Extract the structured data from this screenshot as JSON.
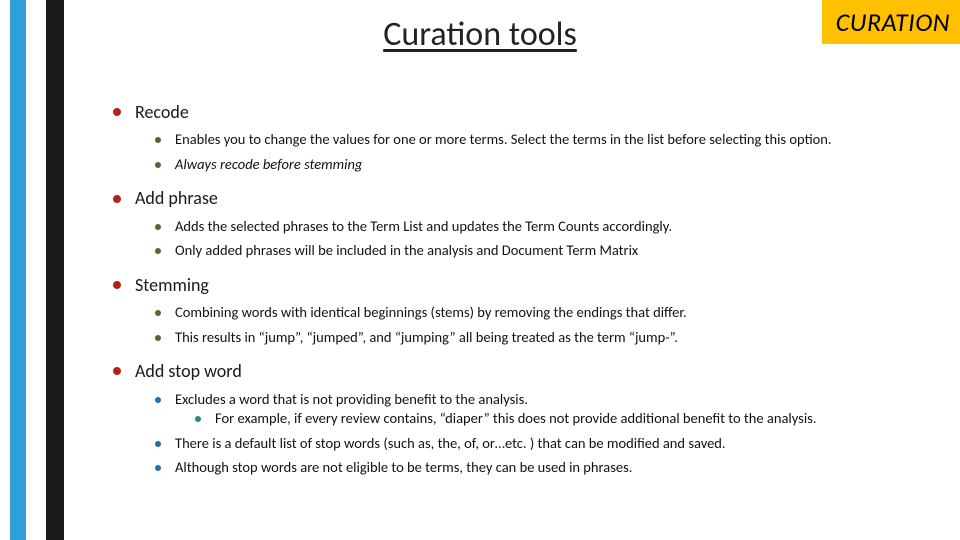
{
  "title": "Curation tools",
  "badge": "CURATION",
  "sections": [
    {
      "heading": "Recode",
      "items": [
        {
          "text": "Enables you to change the values for one or more terms. Select the terms in the list before selecting this option."
        },
        {
          "text": "Always recode before stemming",
          "italic": true
        }
      ]
    },
    {
      "heading": "Add phrase",
      "items": [
        {
          "text": "Adds the selected phrases to the Term List and updates the Term Counts accordingly."
        },
        {
          "text": "Only added phrases will be included in the analysis and Document Term Matrix"
        }
      ]
    },
    {
      "heading": "Stemming",
      "items": [
        {
          "text": "Combining words with identical beginnings (stems) by removing the endings that differ."
        },
        {
          "text": "This results in “jump”, “jumped”, and “jumping” all being treated as the term “jump-”."
        }
      ]
    },
    {
      "heading": "Add stop word",
      "items": [
        {
          "text": "Excludes a word that is not providing benefit to the analysis.",
          "children": [
            {
              "text": "For example, if every review contains, “diaper” this does not provide additional benefit to the analysis."
            }
          ]
        },
        {
          "text": "There is a default list of stop words (such as, the, of, or…etc. ) that can be modified and saved."
        },
        {
          "text": "Although stop words are not eligible to be terms, they can be used in phrases."
        }
      ]
    }
  ]
}
